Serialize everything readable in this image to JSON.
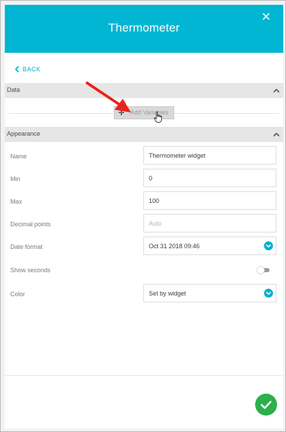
{
  "header": {
    "title": "Thermometer",
    "close_icon": "close-icon",
    "background_color": "#00b6d3"
  },
  "nav": {
    "back_label": "BACK",
    "back_icon": "chevron-left-icon"
  },
  "sections": {
    "data": {
      "label": "Data",
      "collapse_icon": "chevron-up-icon",
      "add_variables_label": "Add Variables",
      "add_icon": "plus-icon"
    },
    "appearance": {
      "label": "Appearance",
      "collapse_icon": "chevron-up-icon"
    }
  },
  "form": {
    "name": {
      "label": "Name",
      "value": "Thermometer widget"
    },
    "min": {
      "label": "Min",
      "value": "0"
    },
    "max": {
      "label": "Max",
      "value": "100"
    },
    "decimal_points": {
      "label": "Decimal points",
      "value": "",
      "placeholder": "Auto"
    },
    "date_format": {
      "label": "Date format",
      "value": "Oct 31 2018 09:46",
      "icon": "chevron-down-icon"
    },
    "show_seconds": {
      "label": "Show seconds",
      "enabled": false
    },
    "color": {
      "label": "Color",
      "value": "Set by widget",
      "icon": "chevron-down-icon"
    }
  },
  "footer": {
    "confirm_icon": "checkmark-icon",
    "confirm_color": "#2db04b"
  },
  "accent_color": "#00b0d0",
  "annotation_arrow_color": "#e8231f"
}
